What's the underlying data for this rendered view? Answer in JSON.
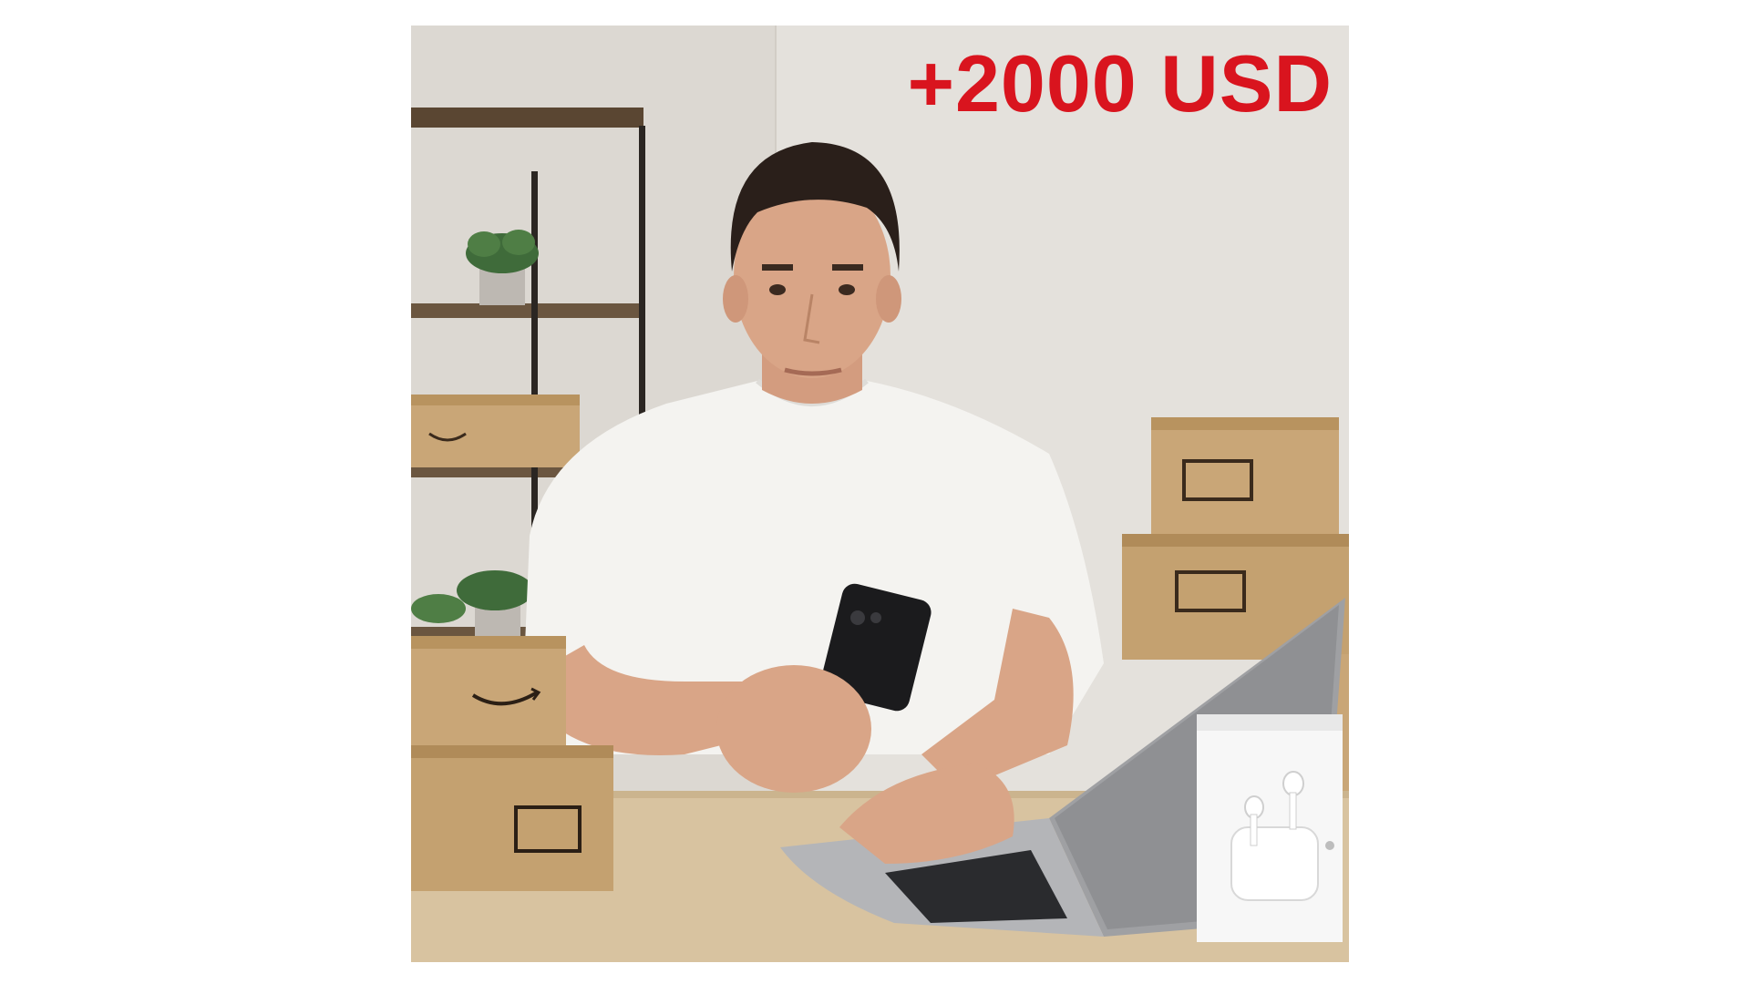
{
  "overlay": {
    "text": "+2000 USD",
    "color": "#d9141e"
  },
  "palette": {
    "wall": "#e4e1dc",
    "desk": "#d8c3a0",
    "cardboard": "#c9a677",
    "shirt": "#f4f3f0",
    "skin": "#d9a587",
    "hair": "#2a1f1a",
    "laptop": "#9fa0a3",
    "phone": "#1b1b1d",
    "earbuds_box": "#f7f7f7"
  },
  "scene": {
    "subject": "person-with-phone-and-laptop",
    "objects": [
      "shelf",
      "potted-plant",
      "shipping-box",
      "laptop",
      "smartphone",
      "earbuds-box"
    ]
  }
}
